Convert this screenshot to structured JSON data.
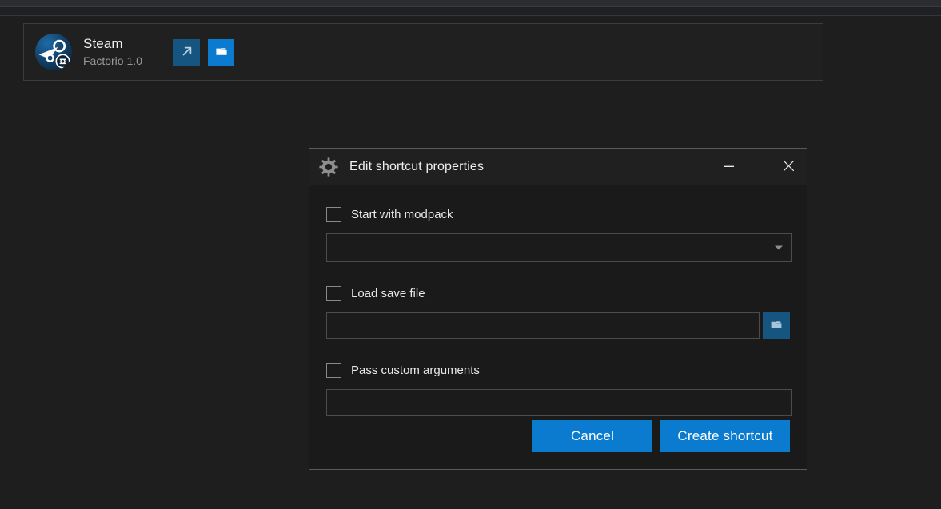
{
  "window": {
    "background_color": "#1e1e1e",
    "chrome_band_color": "#2b2d30"
  },
  "app_card": {
    "icon": "steam-logo-icon",
    "badge_icon": "link-badge-icon",
    "title": "Steam",
    "subtitle": "Factorio 1.0",
    "actions": [
      {
        "name": "launch-button",
        "icon": "external-link-arrow-icon",
        "color": "#16557f"
      },
      {
        "name": "open-folder-button",
        "icon": "folder-icon",
        "color": "#0a7bce"
      }
    ]
  },
  "dialog": {
    "icon": "gear-icon",
    "title": "Edit shortcut properties",
    "minimize_label": "—",
    "close_label": "✕",
    "fields": [
      {
        "name": "start-with-modpack",
        "label": "Start with modpack",
        "checked": false,
        "control": "combobox",
        "value": "",
        "placeholder": ""
      },
      {
        "name": "load-save-file",
        "label": "Load save file",
        "checked": false,
        "control": "text-with-browse",
        "value": "",
        "placeholder": "",
        "browse_icon": "folder-icon"
      },
      {
        "name": "pass-custom-arguments",
        "label": "Pass custom arguments",
        "checked": false,
        "control": "text",
        "value": "",
        "placeholder": ""
      }
    ],
    "buttons": {
      "cancel": "Cancel",
      "create": "Create shortcut",
      "accent_color": "#0a7bce"
    }
  }
}
